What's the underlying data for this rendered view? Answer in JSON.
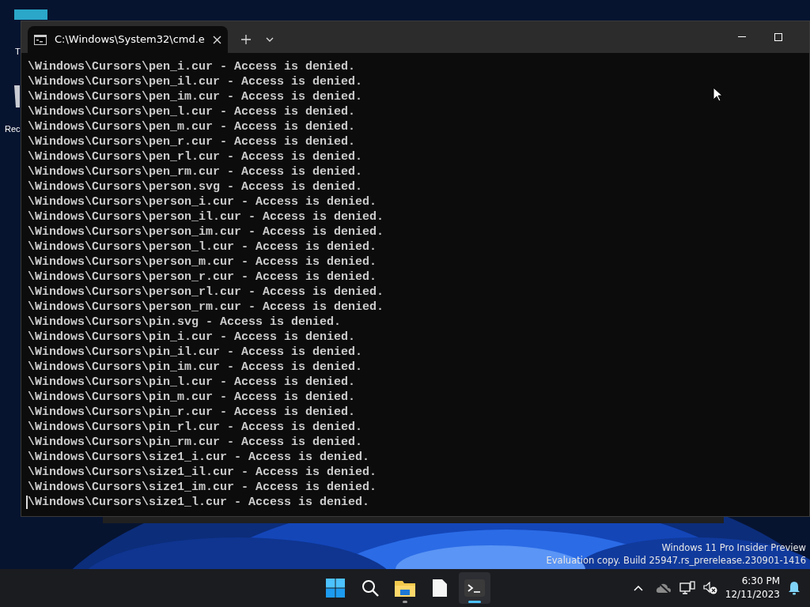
{
  "desktop_icons": [
    {
      "label": "T"
    },
    {
      "label": "Rec"
    }
  ],
  "window": {
    "tab_title": "C:\\Windows\\System32\\cmd.e",
    "lines": [
      "\\Windows\\Cursors\\pen_i.cur - Access is denied.",
      "\\Windows\\Cursors\\pen_il.cur - Access is denied.",
      "\\Windows\\Cursors\\pen_im.cur - Access is denied.",
      "\\Windows\\Cursors\\pen_l.cur - Access is denied.",
      "\\Windows\\Cursors\\pen_m.cur - Access is denied.",
      "\\Windows\\Cursors\\pen_r.cur - Access is denied.",
      "\\Windows\\Cursors\\pen_rl.cur - Access is denied.",
      "\\Windows\\Cursors\\pen_rm.cur - Access is denied.",
      "\\Windows\\Cursors\\person.svg - Access is denied.",
      "\\Windows\\Cursors\\person_i.cur - Access is denied.",
      "\\Windows\\Cursors\\person_il.cur - Access is denied.",
      "\\Windows\\Cursors\\person_im.cur - Access is denied.",
      "\\Windows\\Cursors\\person_l.cur - Access is denied.",
      "\\Windows\\Cursors\\person_m.cur - Access is denied.",
      "\\Windows\\Cursors\\person_r.cur - Access is denied.",
      "\\Windows\\Cursors\\person_rl.cur - Access is denied.",
      "\\Windows\\Cursors\\person_rm.cur - Access is denied.",
      "\\Windows\\Cursors\\pin.svg - Access is denied.",
      "\\Windows\\Cursors\\pin_i.cur - Access is denied.",
      "\\Windows\\Cursors\\pin_il.cur - Access is denied.",
      "\\Windows\\Cursors\\pin_im.cur - Access is denied.",
      "\\Windows\\Cursors\\pin_l.cur - Access is denied.",
      "\\Windows\\Cursors\\pin_m.cur - Access is denied.",
      "\\Windows\\Cursors\\pin_r.cur - Access is denied.",
      "\\Windows\\Cursors\\pin_rl.cur - Access is denied.",
      "\\Windows\\Cursors\\pin_rm.cur - Access is denied.",
      "\\Windows\\Cursors\\size1_i.cur - Access is denied.",
      "\\Windows\\Cursors\\size1_il.cur - Access is denied.",
      "\\Windows\\Cursors\\size1_im.cur - Access is denied.",
      "\\Windows\\Cursors\\size1_l.cur - Access is denied."
    ]
  },
  "watermark": [
    "Windows 11 Pro Insider Preview",
    "Evaluation copy. Build 25947.rs_prerelease.230901-1416"
  ],
  "taskbar": {
    "apps": [
      {
        "kind": "start",
        "selected": false
      },
      {
        "kind": "search",
        "selected": false
      },
      {
        "kind": "explorer",
        "selected": false
      },
      {
        "kind": "notepad",
        "selected": false
      },
      {
        "kind": "terminal",
        "selected": true
      }
    ],
    "time": "6:30 PM",
    "date": "12/11/2023"
  }
}
